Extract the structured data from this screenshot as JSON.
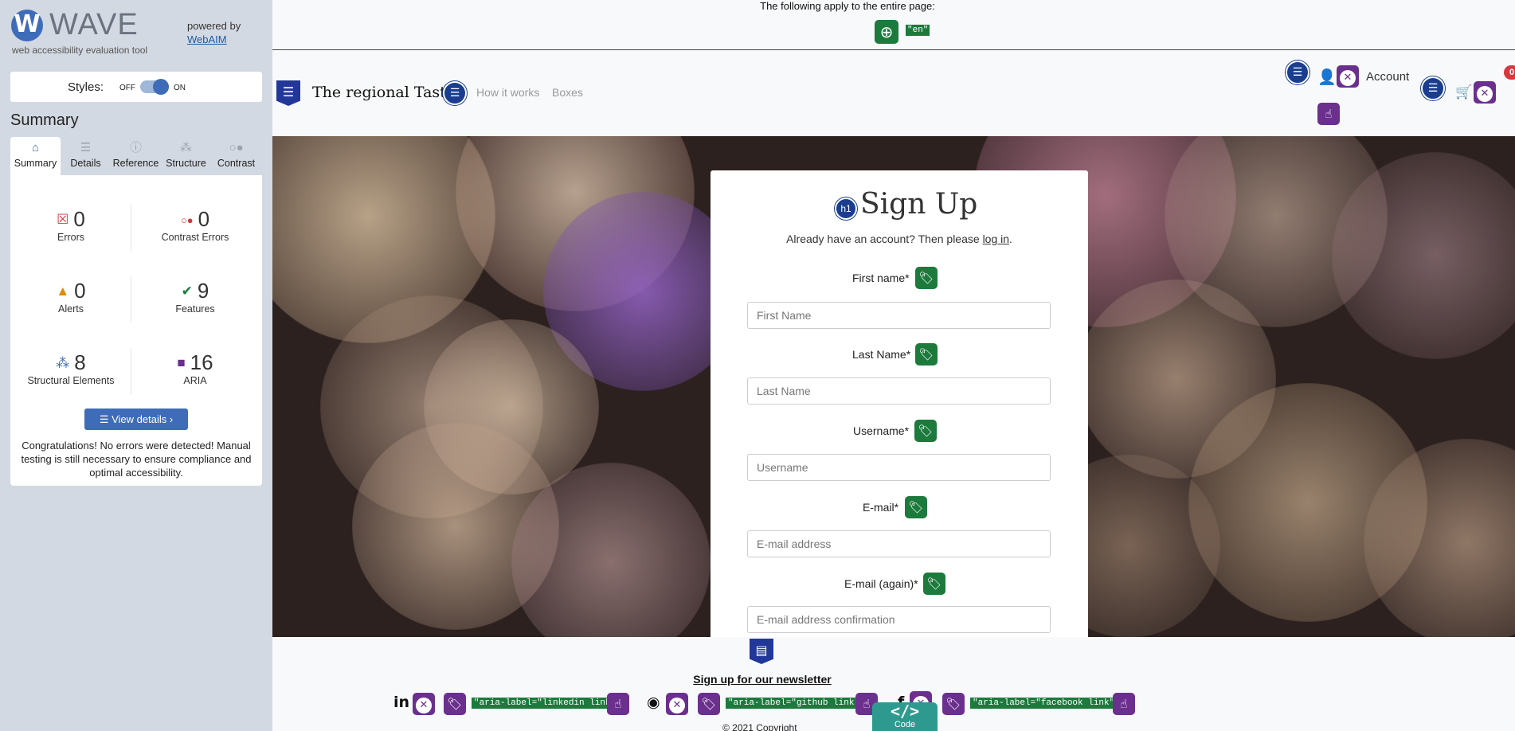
{
  "wave": {
    "title": "WAVE",
    "tagline": "web accessibility evaluation tool",
    "powered_by": "powered by",
    "webaim": "WebAIM",
    "styles_label": "Styles:",
    "styles_off": "OFF",
    "styles_on": "ON",
    "styles_state": "on",
    "summary_title": "Summary",
    "tabs": [
      {
        "label": "Summary",
        "icon": "home-icon",
        "active": true
      },
      {
        "label": "Details",
        "icon": "list-icon",
        "active": false
      },
      {
        "label": "Reference",
        "icon": "info-icon",
        "active": false
      },
      {
        "label": "Structure",
        "icon": "structure-icon",
        "active": false
      },
      {
        "label": "Contrast",
        "icon": "contrast-icon",
        "active": false
      }
    ],
    "stats": {
      "errors": {
        "value": "0",
        "label": "Errors"
      },
      "contrast_errors": {
        "value": "0",
        "label": "Contrast Errors"
      },
      "alerts": {
        "value": "0",
        "label": "Alerts"
      },
      "features": {
        "value": "9",
        "label": "Features"
      },
      "structural": {
        "value": "8",
        "label": "Structural Elements"
      },
      "aria": {
        "value": "16",
        "label": "ARIA"
      }
    },
    "view_details": "View details ›",
    "congrats": "Congratulations! No errors were detected! Manual testing is still necessary to ensure compliance and optimal accessibility.",
    "colors": {
      "accent": "#3f6cb8",
      "error": "#d03a3a",
      "alert": "#e08a00",
      "feature": "#1c7a3c",
      "aria": "#6b2f8e"
    }
  },
  "page": {
    "lang_note": "The following apply to the entire page:",
    "lang_code": "\"en\"",
    "brand": "The regional Taste",
    "nav": [
      "How it works",
      "Boxes"
    ],
    "account": "Account",
    "cart_count": "0",
    "form": {
      "title": "Sign Up",
      "h1_badge": "h1",
      "subtitle_prefix": "Already have an account? Then please ",
      "subtitle_link": "log in",
      "subtitle_suffix": ".",
      "fields": [
        {
          "label": "First name*",
          "placeholder": "First Name"
        },
        {
          "label": "Last Name*",
          "placeholder": "Last Name"
        },
        {
          "label": "Username*",
          "placeholder": "Username"
        },
        {
          "label": "E-mail*",
          "placeholder": "E-mail address"
        },
        {
          "label": "E-mail (again)*",
          "placeholder": "E-mail address confirmation"
        }
      ]
    },
    "footer": {
      "newsletter": "Sign up for our newsletter",
      "social": [
        {
          "icon": "linkedin-icon",
          "glyph": "in",
          "aria": "\"aria-label=\"linkedin link\"\""
        },
        {
          "icon": "github-icon",
          "glyph": "◉",
          "aria": "\"aria-label=\"github link\"\""
        },
        {
          "icon": "facebook-icon",
          "glyph": "f",
          "aria": "\"aria-label=\"facebook link\"\""
        }
      ],
      "copyright": "© 2021 Copyright",
      "code_label": "Code"
    }
  }
}
